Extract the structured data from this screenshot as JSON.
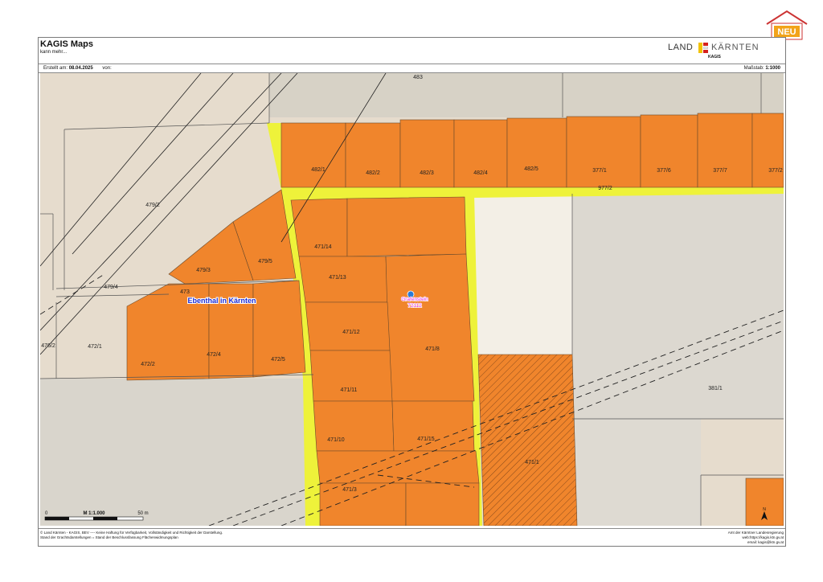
{
  "header": {
    "title": "KAGIS Maps",
    "subtitle": "kann mehr...",
    "logo_left": "LAND",
    "logo_right": "KÄRNTEN",
    "logo_sub": "KAGIS"
  },
  "meta": {
    "created_label": "Erstellt am:",
    "created_date": "08.04.2025",
    "from_label": "von:",
    "scale_label": "Maßstab:",
    "scale_value": "1:1000"
  },
  "badge": {
    "text": "NEU"
  },
  "map": {
    "place_label": "Ebenthal in Kärnten",
    "marker_label_1": "Grafenstein",
    "marker_label_2": "72112",
    "parcels": [
      "483",
      "482/1",
      "482/2",
      "482/3",
      "482/4",
      "482/5",
      "377/1",
      "377/6",
      "377/7",
      "377/2",
      "977/2",
      "479/2",
      "479/3",
      "479/5",
      "479/4",
      "473",
      "471/14",
      "471/13",
      "471/12",
      "471/8",
      "471/11",
      "471/10",
      "471/15",
      "471/1",
      "471/3",
      "476/2",
      "472/1",
      "472/2",
      "472/4",
      "472/5",
      "381/1"
    ],
    "scalebar": {
      "start": "0",
      "mid": "M 1:1.000",
      "end": "50 m"
    },
    "north": "N"
  },
  "footer": {
    "left_1": "© Land Kärnten - KAGIS, BEV ---- Keine Haftung für Verfügbarkeit, Vollständigkeit und Richtigkeit der Darstellung.",
    "left_2": "Stand der Grachtsdarstellungen = Stand der Beschlussfassung Flächenwidmungsplan",
    "right_1": "Amt der Kärntner Landesregierung",
    "right_2": "web:https://kagis.ktn.gv.at",
    "right_3": "email: kagis@ktn.gv.at"
  },
  "colors": {
    "orange": "#f0852c",
    "yellow": "#eef23a",
    "background": "#e9e1d3",
    "outline": "#555555"
  }
}
